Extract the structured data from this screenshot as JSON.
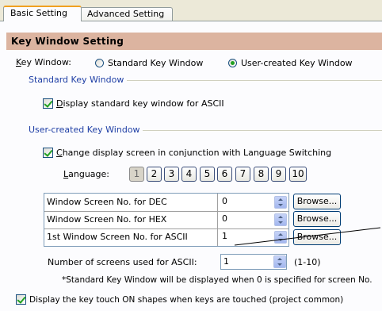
{
  "tabs": [
    "Basic Setting",
    "Advanced Setting"
  ],
  "section_title": "Key Window Setting",
  "key_window": {
    "label": "Key Window:",
    "options": [
      "Standard Key Window",
      "User-created Key Window"
    ],
    "selected": "User-created Key Window"
  },
  "standard_group": {
    "title": "Standard Key Window",
    "checkbox_label": "Display standard key window for ASCII",
    "checked": true
  },
  "user_group": {
    "title": "User-created Key Window",
    "checkbox_label": "Change display screen in conjunction with Language Switching",
    "checked": true,
    "language_label": "Language:",
    "language_buttons": [
      "1",
      "2",
      "3",
      "4",
      "5",
      "6",
      "7",
      "8",
      "9",
      "10"
    ],
    "language_selected": "1",
    "rows": [
      {
        "label": "Window Screen No. for DEC",
        "value": "0",
        "button": "Browse..."
      },
      {
        "label": "Window Screen No. for HEX",
        "value": "0",
        "button": "Browse..."
      },
      {
        "label": "1st Window Screen No. for ASCII",
        "value": "1",
        "button": "Browse..."
      }
    ],
    "screens_label": "Number of screens used for ASCII:",
    "screens_value": "1",
    "screens_range": "(1-10)",
    "note": "*Standard Key Window will be displayed when 0 is specified for screen No."
  },
  "bottom_checkbox": {
    "label": "Display the key touch ON shapes when keys are touched (project common)",
    "checked": true
  },
  "colors": {
    "title_bg": "#dcb4a0",
    "group_text": "#1f3fa5",
    "check_mark": "#21a121"
  }
}
